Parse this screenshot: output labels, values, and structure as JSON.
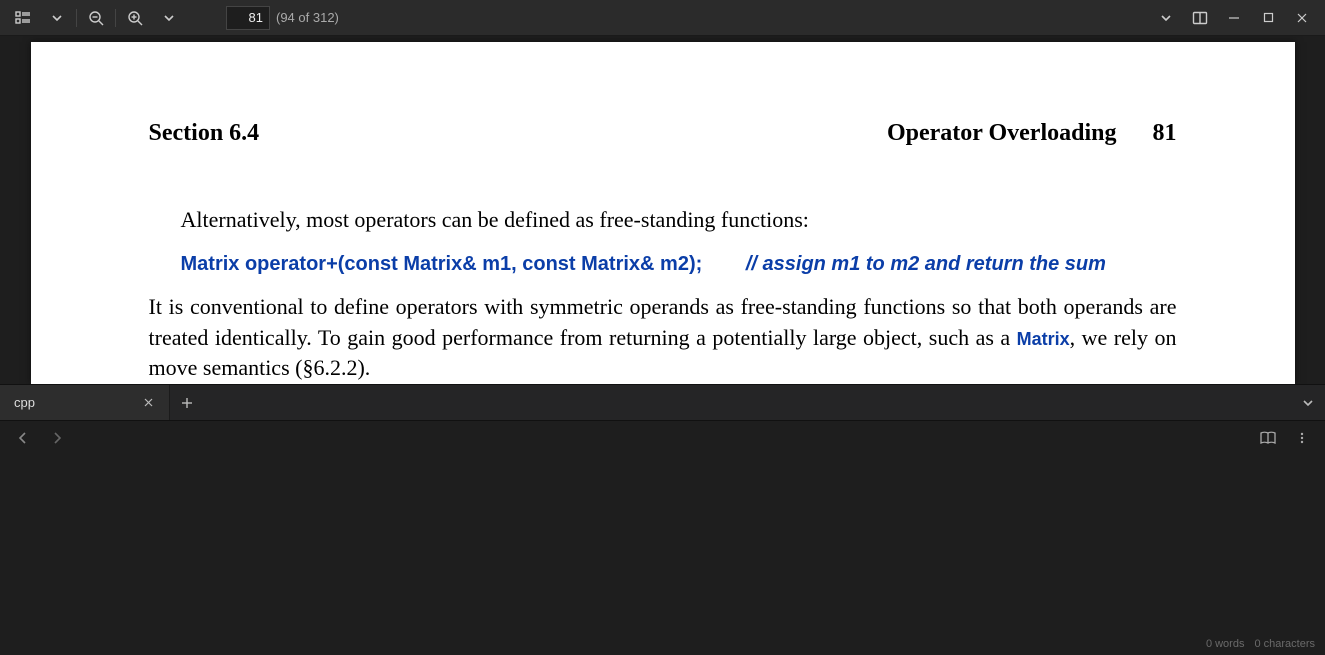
{
  "pdf": {
    "toolbar": {
      "page_input": "81",
      "page_count_label": "(94 of 312)"
    },
    "page": {
      "section_label": "Section 6.4",
      "header_title": "Operator Overloading",
      "page_number": "81",
      "para1": "Alternatively, most operators can be defined as free-standing functions:",
      "code_decl": "Matrix operator+(const Matrix& m1, const Matrix& m2);",
      "code_comment": "// assign m1 to m2 and return the sum",
      "para2a": "It is conventional to define operators with symmetric operands as free-standing functions so that both operands are treated identically.  To gain good performance from returning a potentially large object, such as a ",
      "inline_code": "Matrix",
      "para2b": ", we rely on move semantics (§6.2.2)."
    }
  },
  "editor": {
    "tab_label": "cpp",
    "status_words": "0 words",
    "status_chars": "0 characters"
  }
}
